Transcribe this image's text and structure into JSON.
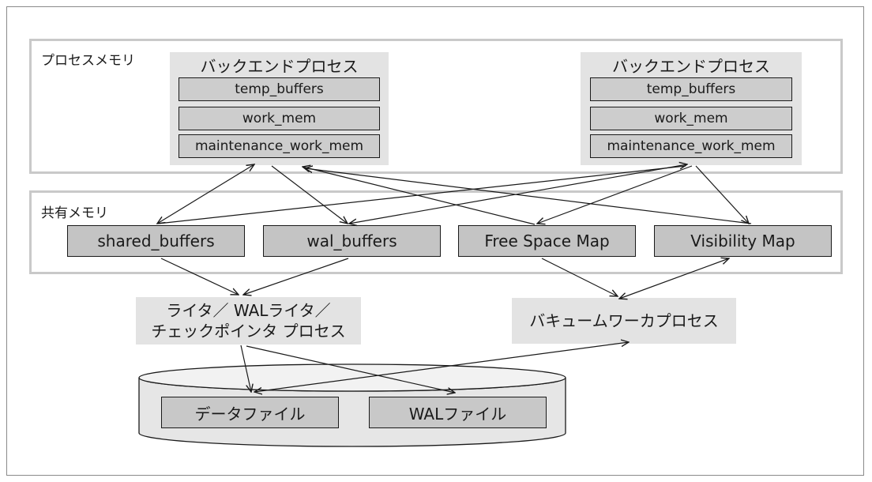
{
  "process_memory": {
    "label": "プロセスメモリ",
    "backends": [
      {
        "title": "バックエンドプロセス",
        "items": [
          "temp_buffers",
          "work_mem",
          "maintenance_work_mem"
        ]
      },
      {
        "title": "バックエンドプロセス",
        "items": [
          "temp_buffers",
          "work_mem",
          "maintenance_work_mem"
        ]
      }
    ]
  },
  "shared_memory": {
    "label": "共有メモリ",
    "items": [
      "shared_buffers",
      "wal_buffers",
      "Free Space Map",
      "Visibility Map"
    ]
  },
  "writer_process": {
    "line1": "ライタ／ WALライタ／",
    "line2": "チェックポインタ プロセス"
  },
  "vacuum_process": {
    "label": "バキュームワーカプロセス"
  },
  "storage": {
    "items": [
      "データファイル",
      "WALファイル"
    ]
  }
}
